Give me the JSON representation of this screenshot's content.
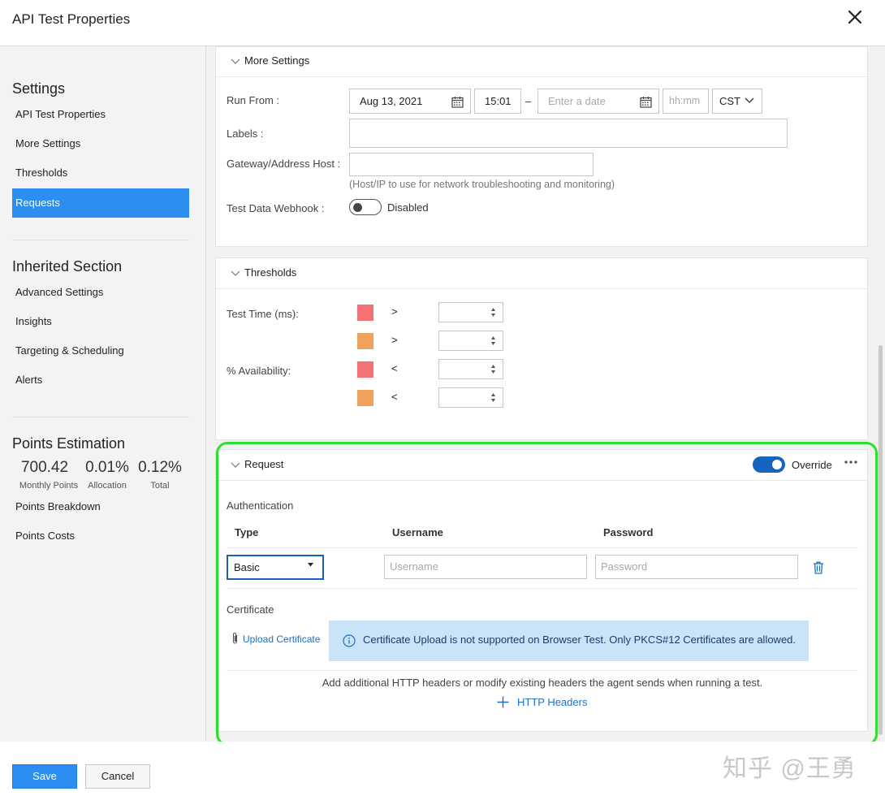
{
  "header": {
    "title": "API Test Properties"
  },
  "sidebar": {
    "settings_heading": "Settings",
    "settings_items": [
      {
        "label": "API Test Properties"
      },
      {
        "label": "More Settings"
      },
      {
        "label": "Thresholds"
      },
      {
        "label": "Requests",
        "active": true
      }
    ],
    "inherited_heading": "Inherited Section",
    "inherited_items": [
      {
        "label": "Advanced Settings"
      },
      {
        "label": "Insights"
      },
      {
        "label": "Targeting & Scheduling"
      },
      {
        "label": "Alerts"
      }
    ],
    "points": {
      "heading": "Points Estimation",
      "monthly_value": "700.42",
      "monthly_label": "Monthly Points",
      "allocation_value": "0.01%",
      "allocation_label": "Allocation",
      "total_value": "0.12%",
      "total_label": "Total",
      "links": [
        {
          "label": "Points Breakdown"
        },
        {
          "label": "Points Costs"
        }
      ]
    }
  },
  "more_settings": {
    "title": "More Settings",
    "run_from_label": "Run From :",
    "start_date": "Aug 13, 2021",
    "start_time": "15:01",
    "range_sep": "–",
    "end_date_placeholder": "Enter a date",
    "end_time_placeholder": "hh:mm",
    "timezone": "CST",
    "labels_label": "Labels :",
    "gateway_label": "Gateway/Address Host :",
    "gateway_helper": "(Host/IP to use for network troubleshooting and monitoring)",
    "webhook_label": "Test Data Webhook :",
    "webhook_state": "Disabled"
  },
  "thresholds": {
    "title": "Thresholds",
    "test_time_label": "Test Time (ms):",
    "availability_label": "% Availability:",
    "rows": [
      {
        "color": "#f47174",
        "operator": ">"
      },
      {
        "color": "#efa25e",
        "operator": ">"
      },
      {
        "color": "#f47174",
        "operator": "<"
      },
      {
        "color": "#efa25e",
        "operator": "<"
      }
    ]
  },
  "request": {
    "title": "Request",
    "override_label": "Override",
    "override_on": true,
    "more_icon": "ellipsis-icon",
    "auth_heading": "Authentication",
    "col_type": "Type",
    "col_username": "Username",
    "col_password": "Password",
    "type_value": "Basic",
    "username_placeholder": "Username",
    "password_placeholder": "Password",
    "certificate_heading": "Certificate",
    "upload_label": "Upload Certificate",
    "info_text": "Certificate Upload is not supported on Browser Test. Only PKCS#12 Certificates are allowed.",
    "headers_hint": "Add additional HTTP headers or modify existing headers the agent sends when running a test.",
    "add_headers_label": "HTTP Headers"
  },
  "footer": {
    "save_label": "Save",
    "cancel_label": "Cancel",
    "watermark": "知乎 @王勇"
  },
  "colors": {
    "accent": "#2b8ef0",
    "toggle_on": "#1565c0",
    "highlight": "#2de02d",
    "info_bg": "#c9e3f8"
  }
}
